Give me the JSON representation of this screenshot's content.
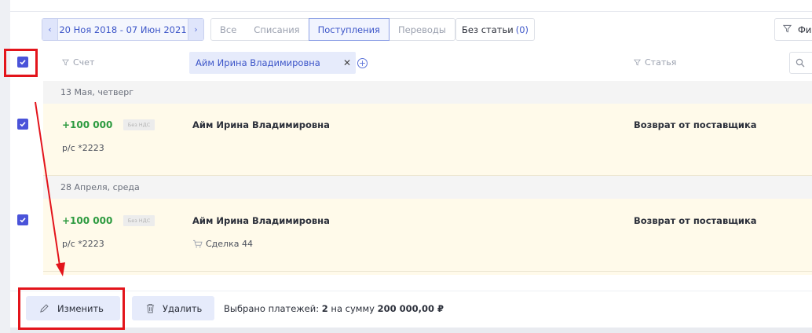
{
  "toolbar": {
    "date_range": "20 Ноя 2018 - 07 Июн 2021",
    "segments": [
      "Все",
      "Списания",
      "Поступления",
      "Переводы"
    ],
    "active_segment": "Поступления",
    "no_article_label": "Без статьи",
    "no_article_count": "(0)",
    "filter_label": "Фи"
  },
  "header": {
    "col_account": "Счет",
    "counterparty_filter": "Айм Ирина Владимировна",
    "col_article": "Статья"
  },
  "groups": [
    {
      "date": "13 Мая, четверг",
      "amount": "+100 000",
      "vat": "Без НДС",
      "counterparty": "Айм Ирина Владимировна",
      "article": "Возврат от поставщика",
      "account": "р/с *2223",
      "deal": ""
    },
    {
      "date": "28 Апреля, среда",
      "amount": "+100 000",
      "vat": "Без НДС",
      "counterparty": "Айм Ирина Владимировна",
      "article": "Возврат от поставщика",
      "account": "р/с *2223",
      "deal": "Сделка 44"
    }
  ],
  "actions": {
    "edit_label": "Изменить",
    "delete_label": "Удалить",
    "summary_prefix": "Выбрано платежей:",
    "summary_count": "2",
    "summary_middle": "на сумму",
    "summary_total": "200 000,00 ₽"
  },
  "colors": {
    "accent": "#3c55c8",
    "checkbox": "#4a53d9",
    "income_green": "#2c9a3f",
    "row_highlight": "#fffaea",
    "annotation_red": "#e3141b"
  }
}
